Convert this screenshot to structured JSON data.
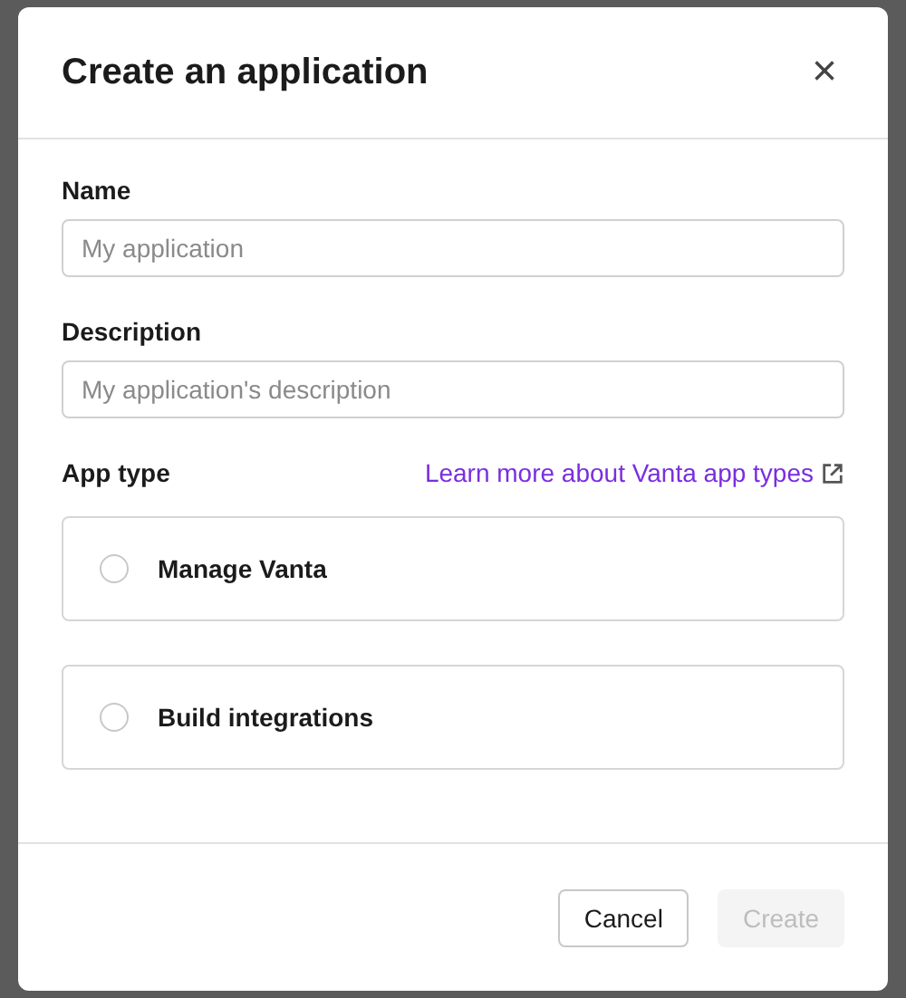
{
  "dialog": {
    "title": "Create an application",
    "close": "×"
  },
  "fields": [
    {
      "label": "Name",
      "placeholder": "My application"
    },
    {
      "label": "Description",
      "placeholder": "My application's description"
    }
  ],
  "app_type": {
    "label": "App type",
    "link": "Learn more about Vanta app types",
    "options": [
      {
        "label": "Manage Vanta",
        "selected": false
      },
      {
        "label": "Build integrations",
        "selected": false
      }
    ]
  },
  "buttons": [
    {
      "label": "Cancel",
      "disabled": false
    },
    {
      "label": "Create",
      "disabled": true
    }
  ]
}
